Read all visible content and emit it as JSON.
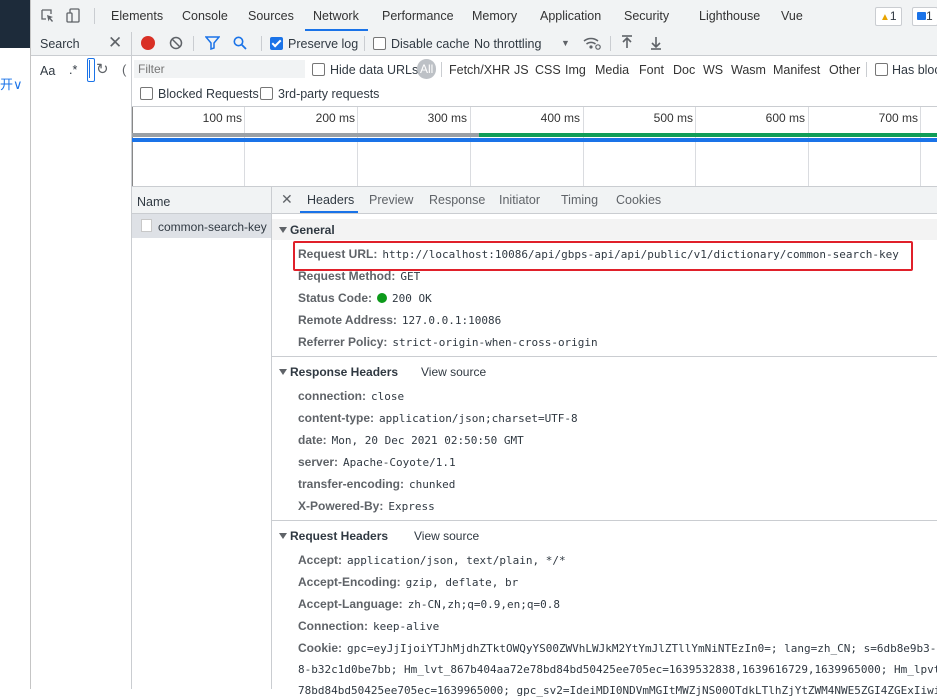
{
  "colors": {
    "accent": "#1a73e8",
    "record": "#d93025",
    "status_ok": "#0c9a1a",
    "highlight_box": "#e0202a",
    "waterfall_blue": "#1a73e8",
    "waterfall_green": "#0f9d58"
  },
  "left_strip": {
    "glyph": "开∨"
  },
  "top_tabs": [
    "Elements",
    "Console",
    "Sources",
    "Network",
    "Performance",
    "Memory",
    "Application",
    "Security",
    "Lighthouse",
    "Vue"
  ],
  "active_tab": "Network",
  "badges": {
    "warnings": "1",
    "messages": "1"
  },
  "search_panel": {
    "title": "Search",
    "aa": "Aa",
    "regex": ".*"
  },
  "toolbar": {
    "preserve_log": "Preserve log",
    "disable_cache": "Disable cache",
    "throttling": "No throttling"
  },
  "filter": {
    "placeholder": "Filter",
    "hide_data_urls": "Hide data URLs",
    "types": [
      "All",
      "Fetch/XHR",
      "JS",
      "CSS",
      "Img",
      "Media",
      "Font",
      "Doc",
      "WS",
      "Wasm",
      "Manifest",
      "Other"
    ],
    "has_blocked": "Has bloc",
    "blocked_requests": "Blocked Requests",
    "third_party": "3rd-party requests"
  },
  "timeline": {
    "ticks": [
      "100 ms",
      "200 ms",
      "300 ms",
      "400 ms",
      "500 ms",
      "600 ms",
      "700 ms"
    ]
  },
  "request_list": {
    "header": "Name",
    "items": [
      "common-search-key"
    ]
  },
  "detail_tabs": [
    "Headers",
    "Preview",
    "Response",
    "Initiator",
    "Timing",
    "Cookies"
  ],
  "active_detail_tab": "Headers",
  "general": {
    "title": "General",
    "rows": [
      {
        "key": "Request URL:",
        "value": "http://localhost:10086/api/gbps-api/api/public/v1/dictionary/common-search-key"
      },
      {
        "key": "Request Method:",
        "value": "GET"
      },
      {
        "key": "Status Code:",
        "value": "200 OK"
      },
      {
        "key": "Remote Address:",
        "value": "127.0.0.1:10086"
      },
      {
        "key": "Referrer Policy:",
        "value": "strict-origin-when-cross-origin"
      }
    ]
  },
  "response_headers": {
    "title": "Response Headers",
    "view_source": "View source",
    "rows": [
      {
        "key": "connection:",
        "value": "close"
      },
      {
        "key": "content-type:",
        "value": "application/json;charset=UTF-8"
      },
      {
        "key": "date:",
        "value": "Mon, 20 Dec 2021 02:50:50 GMT"
      },
      {
        "key": "server:",
        "value": "Apache-Coyote/1.1"
      },
      {
        "key": "transfer-encoding:",
        "value": "chunked"
      },
      {
        "key": "X-Powered-By:",
        "value": "Express"
      }
    ]
  },
  "request_headers": {
    "title": "Request Headers",
    "view_source": "View source",
    "rows": [
      {
        "key": "Accept:",
        "value": "application/json, text/plain, */*"
      },
      {
        "key": "Accept-Encoding:",
        "value": "gzip, deflate, br"
      },
      {
        "key": "Accept-Language:",
        "value": "zh-CN,zh;q=0.9,en;q=0.8"
      },
      {
        "key": "Connection:",
        "value": "keep-alive"
      },
      {
        "key": "Cookie:",
        "value": "gpc=eyJjIjoiYTJhMjdhZTktOWQyYS00ZWVhLWJkM2YtYmJlZTllYmNiNTEzIn0=; lang=zh_CN; s=6db8e9b3-2"
      }
    ],
    "cookie_cont": "8-b32c1d0be7bb; Hm_lvt_867b404aa72e78bd84bd50425ee705ec=1639532838,1639616729,1639965000; Hm_lpvt",
    "cookie_cont2": "78bd84bd50425ee705ec=1639965000; gpc_sv2=IdeiMDI0NDVmMGItMWZjNS00OTdkLTlhZjYtZWM4NWE5ZGI4ZGExIiwi"
  }
}
